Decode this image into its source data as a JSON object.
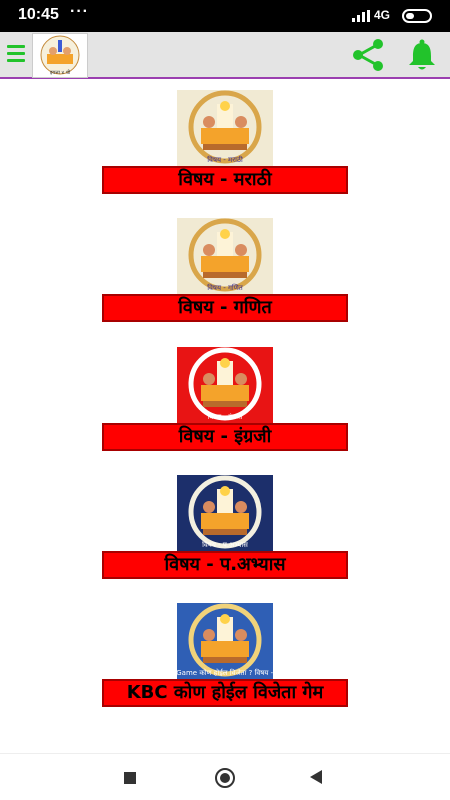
{
  "status_bar": {
    "time": "10:45",
    "dots": "···",
    "network": "4G"
  },
  "app_bar": {
    "accent": "#22c32b",
    "divider_color": "#9b3fb0",
    "logo_caption": "इयत्ता ४ थी"
  },
  "subjects": [
    {
      "label": "विषय - मराठी",
      "image_caption": "विषय - मराठी",
      "image_theme": "cream"
    },
    {
      "label": "विषय - गणित",
      "image_caption": "विषय - गणित",
      "image_theme": "cream"
    },
    {
      "label": "विषय - इंग्रजी",
      "image_caption": "विषय - इंग्रजी",
      "image_theme": "red"
    },
    {
      "label": "विषय - प.अभ्यास",
      "image_caption": "विषय - प.अभ्यास",
      "image_theme": "navy"
    },
    {
      "label": "KBC कोण होईल विजेता गेम",
      "image_caption": "KBC Game कोण होईल विजेता ? विषय - मराठी",
      "image_theme": "blue"
    }
  ],
  "colors": {
    "button_red": "#ff0000",
    "button_border": "#a80000"
  }
}
